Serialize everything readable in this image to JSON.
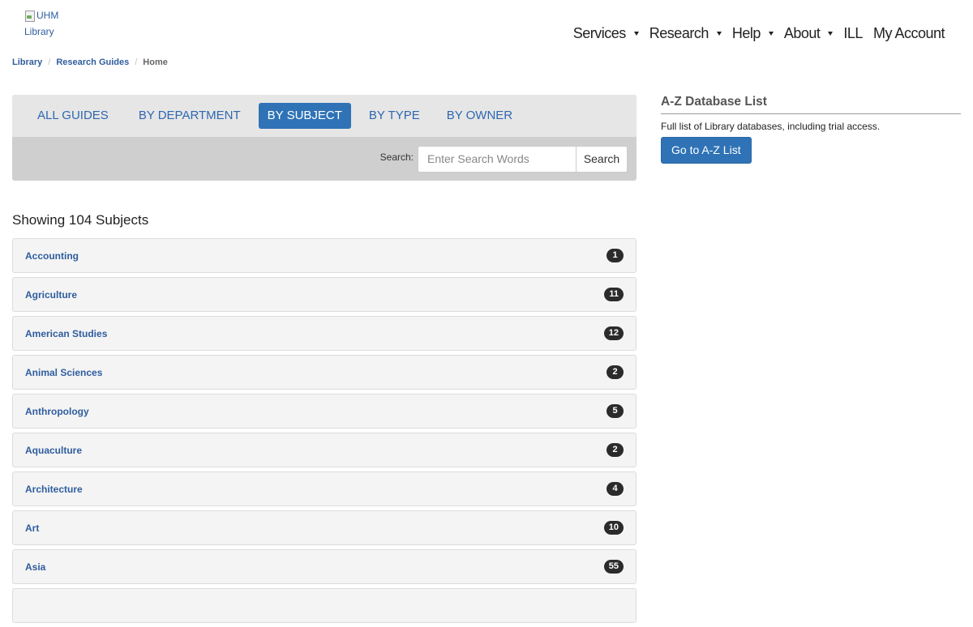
{
  "logo": {
    "alt_line1": "UHM",
    "alt_line2": "Library"
  },
  "topnav": {
    "items": [
      {
        "label": "Services",
        "has_caret": true
      },
      {
        "label": "Research",
        "has_caret": true
      },
      {
        "label": "Help",
        "has_caret": true
      },
      {
        "label": "About",
        "has_caret": true
      },
      {
        "label": "ILL",
        "has_caret": false
      },
      {
        "label": "My Account",
        "has_caret": false
      }
    ]
  },
  "breadcrumb": {
    "items": [
      "Library",
      "Research Guides"
    ],
    "current": "Home"
  },
  "tabs": [
    {
      "label": "ALL GUIDES",
      "active": false
    },
    {
      "label": "BY DEPARTMENT",
      "active": false
    },
    {
      "label": "BY SUBJECT",
      "active": true
    },
    {
      "label": "BY TYPE",
      "active": false
    },
    {
      "label": "BY OWNER",
      "active": false
    }
  ],
  "search": {
    "label": "Search:",
    "placeholder": "Enter Search Words",
    "value": "",
    "button_label": "Search"
  },
  "results": {
    "showing": "Showing 104 Subjects"
  },
  "subjects": [
    {
      "name": "Accounting",
      "count": "1"
    },
    {
      "name": "Agriculture",
      "count": "11"
    },
    {
      "name": "American Studies",
      "count": "12"
    },
    {
      "name": "Animal Sciences",
      "count": "2"
    },
    {
      "name": "Anthropology",
      "count": "5"
    },
    {
      "name": "Aquaculture",
      "count": "2"
    },
    {
      "name": "Architecture",
      "count": "4"
    },
    {
      "name": "Art",
      "count": "10"
    },
    {
      "name": "Asia",
      "count": "55"
    },
    {
      "name": "",
      "count": ""
    }
  ],
  "sidebar": {
    "title": "A-Z Database List",
    "description": "Full list of Library databases, including trial access.",
    "button_label": "Go to A-Z List"
  },
  "colors": {
    "accent": "#2f73b6",
    "link": "#2f5d9e",
    "badge": "#2b2b2b"
  }
}
